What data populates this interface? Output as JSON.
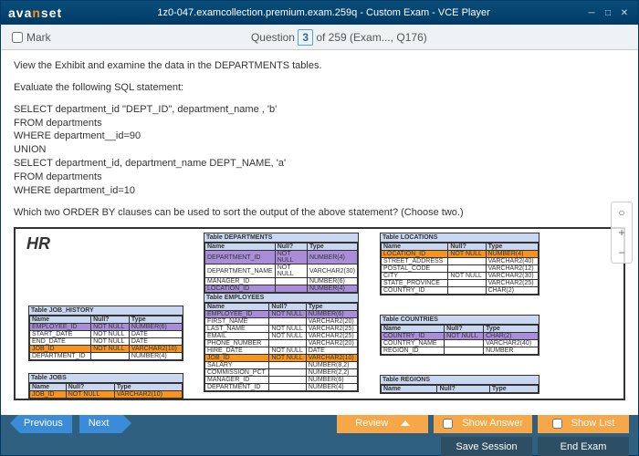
{
  "titlebar": {
    "title": "1z0-047.examcollection.premium.exam.259q - Custom Exam - VCE Player"
  },
  "logo": {
    "pre": "ava",
    "mid": "n",
    "post": "set"
  },
  "toolbar": {
    "mark": "Mark",
    "question_label": "Question",
    "qnum": "3",
    "of": "of 259 (Exam..., Q176)"
  },
  "question": {
    "l1": "View the Exhibit and examine the data in the DEPARTMENTS tables.",
    "l2": "Evaluate the following SQL statement:",
    "l3": "SELECT department_id \"DEPT_ID\", department_name , 'b'",
    "l4": "FROM departments",
    "l5": "WHERE department__id=90",
    "l6": "UNION",
    "l7": "SELECT department_id, department_name DEPT_NAME, 'a'",
    "l8": "FROM departments",
    "l9": "WHERE department_id=10",
    "l10": "Which two ORDER BY clauses can be used to sort the output of the above statement? (Choose two.)"
  },
  "hr": "HR",
  "tables": {
    "dept": {
      "cap": "Table DEPARTMENTS",
      "h": [
        "Name",
        "Null?",
        "Type"
      ],
      "r": [
        [
          "DEPARTMENT_ID",
          "NOT NULL",
          "NUMBER(4)"
        ],
        [
          "DEPARTMENT_NAME",
          "NOT NULL",
          "VARCHAR2(30)"
        ],
        [
          "MANAGER_ID",
          "",
          "NUMBER(6)"
        ],
        [
          "LOCATION_ID",
          "",
          "NUMBER(4)"
        ]
      ]
    },
    "loc": {
      "cap": "Table LOCATIONS",
      "h": [
        "Name",
        "Null?",
        "Type"
      ],
      "r": [
        [
          "LOCATION_ID",
          "NOT NULL",
          "NUMBER(4)"
        ],
        [
          "STREET_ADDRESS",
          "",
          "VARCHAR2(40)"
        ],
        [
          "POSTAL_CODE",
          "",
          "VARCHAR2(12)"
        ],
        [
          "CITY",
          "NOT NULL",
          "VARCHAR2(30)"
        ],
        [
          "STATE_PROVINCE",
          "",
          "VARCHAR2(25)"
        ],
        [
          "COUNTRY_ID",
          "",
          "CHAR(2)"
        ]
      ]
    },
    "jh": {
      "cap": "Table JOB_HISTORY",
      "h": [
        "Name",
        "Null?",
        "Type"
      ],
      "r": [
        [
          "EMPLOYEE_ID",
          "NOT NULL",
          "NUMBER(6)"
        ],
        [
          "START_DATE",
          "NOT NULL",
          "DATE"
        ],
        [
          "END_DATE",
          "NOT NULL",
          "DATE"
        ],
        [
          "JOB_ID",
          "NOT NULL",
          "VARCHAR2(10)"
        ],
        [
          "DEPARTMENT_ID",
          "",
          "NUMBER(4)"
        ]
      ]
    },
    "emp": {
      "cap": "Table EMPLOYEES",
      "h": [
        "Name",
        "Null?",
        "Type"
      ],
      "r": [
        [
          "EMPLOYEE_ID",
          "NOT NULL",
          "NUMBER(6)"
        ],
        [
          "FIRST_NAME",
          "",
          "VARCHAR2(20)"
        ],
        [
          "LAST_NAME",
          "NOT NULL",
          "VARCHAR2(25)"
        ],
        [
          "EMAIL",
          "NOT NULL",
          "VARCHAR2(25)"
        ],
        [
          "PHONE_NUMBER",
          "",
          "VARCHAR2(20)"
        ],
        [
          "HIRE_DATE",
          "NOT NULL",
          "DATE"
        ],
        [
          "JOB_ID",
          "NOT NULL",
          "VARCHAR2(10)"
        ],
        [
          "SALARY",
          "",
          "NUMBER(8,2)"
        ],
        [
          "COMMISSION_PCT",
          "",
          "NUMBER(2,2)"
        ],
        [
          "MANAGER_ID",
          "",
          "NUMBER(6)"
        ],
        [
          "DEPARTMENT_ID",
          "",
          "NUMBER(4)"
        ]
      ]
    },
    "ctry": {
      "cap": "Table COUNTRIES",
      "h": [
        "Name",
        "Null?",
        "Type"
      ],
      "r": [
        [
          "COUNTRY_ID",
          "NOT NULL",
          "CHAR(2)"
        ],
        [
          "COUNTRY_NAME",
          "",
          "VARCHAR2(40)"
        ],
        [
          "REGION_ID",
          "",
          "NUMBER"
        ]
      ]
    },
    "jobs": {
      "cap": "Table JOBS",
      "h": [
        "Name",
        "Null?",
        "Type"
      ],
      "r": [
        [
          "JOB_ID",
          "NOT NULL",
          "VARCHAR2(10)"
        ]
      ]
    },
    "reg": {
      "cap": "Table REGIONS",
      "h": [
        "Name",
        "Null?",
        "Type"
      ]
    }
  },
  "buttons": {
    "prev": "Previous",
    "next": "Next",
    "review": "Review",
    "showans": "Show Answer",
    "showlist": "Show List",
    "save": "Save Session",
    "end": "End Exam"
  }
}
